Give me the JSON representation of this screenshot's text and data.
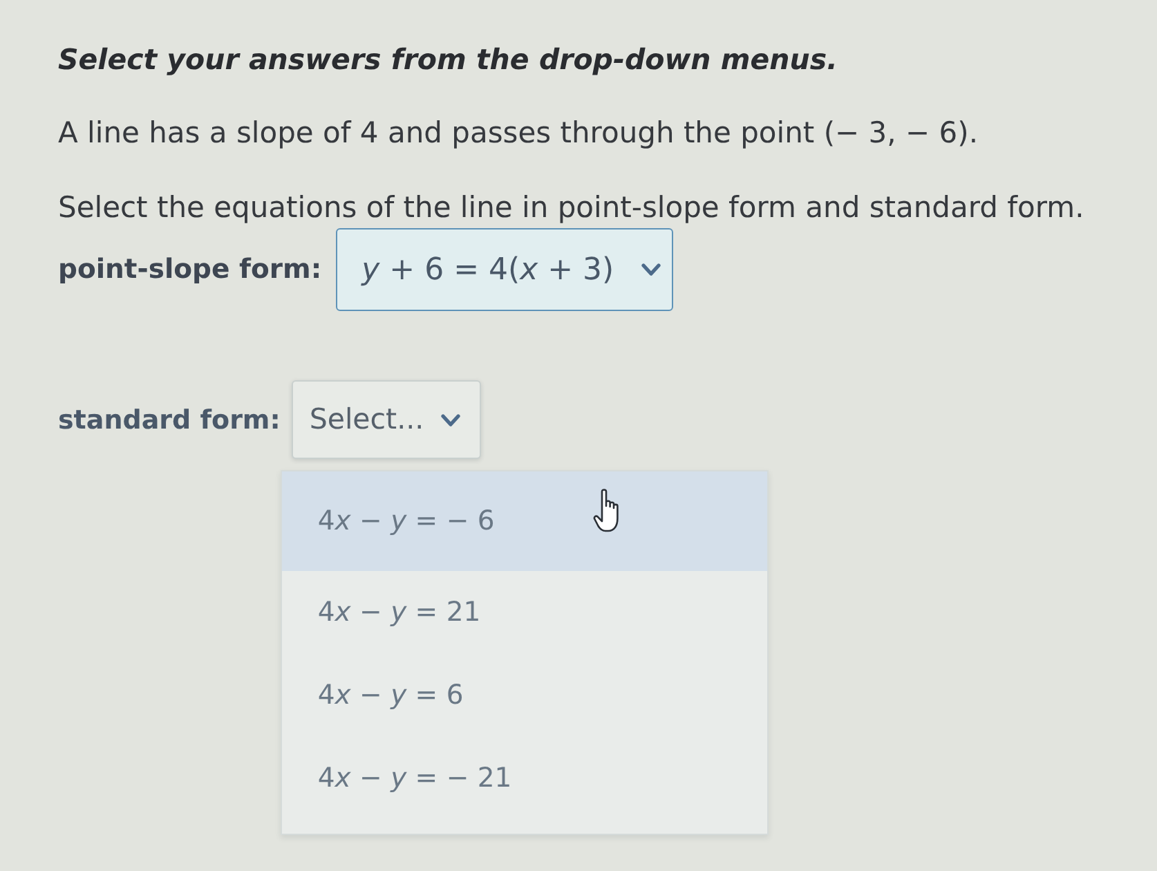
{
  "instruction": "Select your answers from the drop-down menus.",
  "problem": [
    "A line has a slope of 4 and passes through the point (− 3, − 6).",
    "Select the equations of the line in point-slope form and standard form."
  ],
  "dropdowns": [
    {
      "label": "point-slope form:",
      "value": "y + 6 = 4(x + 3)",
      "expanded": false
    },
    {
      "label": "standard form:",
      "placeholder": "Select...",
      "expanded": true,
      "options": [
        {
          "text": "4x − y = − 6",
          "highlighted": true
        },
        {
          "text": "4x − y = 21",
          "highlighted": false
        },
        {
          "text": "4x − y = 6",
          "highlighted": false
        },
        {
          "text": "4x − y = − 21",
          "highlighted": false
        }
      ]
    }
  ]
}
